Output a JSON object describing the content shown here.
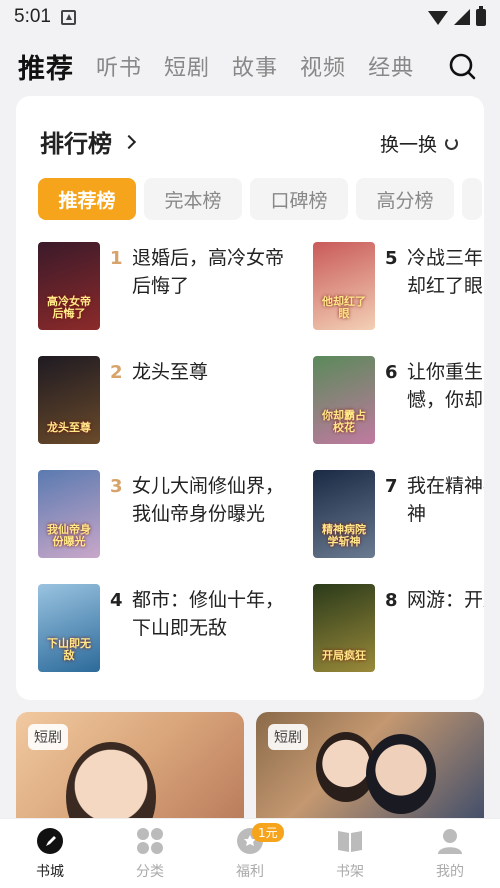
{
  "status_bar": {
    "time": "5:01"
  },
  "top_tabs": [
    {
      "label": "推荐",
      "active": true
    },
    {
      "label": "听书",
      "active": false
    },
    {
      "label": "短剧",
      "active": false
    },
    {
      "label": "故事",
      "active": false
    },
    {
      "label": "视频",
      "active": false
    },
    {
      "label": "经典",
      "active": false
    }
  ],
  "ranking": {
    "title": "排行榜",
    "refresh_label": "换一换",
    "tabs": [
      "推荐榜",
      "完本榜",
      "口碑榜",
      "高分榜"
    ],
    "books": [
      {
        "rank": "1",
        "title": "退婚后，高冷女帝后悔了",
        "cover_text": "高冷女帝后悔了",
        "cover_colors": [
          "#3a1a2a",
          "#8c2a2a"
        ]
      },
      {
        "rank": "2",
        "title": "龙头至尊",
        "cover_text": "龙头至尊",
        "cover_colors": [
          "#1e1a22",
          "#6a4a2a"
        ]
      },
      {
        "rank": "3",
        "title": "女儿大闹修仙界，我仙帝身份曝光",
        "cover_text": "我仙帝身份曝光",
        "cover_colors": [
          "#5a7ab0",
          "#c9a7c9"
        ]
      },
      {
        "rank": "4",
        "title": "都市：修仙十年，下山即无敌",
        "cover_text": "下山即无敌",
        "cover_colors": [
          "#9ac3e0",
          "#2c6a9a"
        ]
      },
      {
        "rank": "5",
        "title": "冷战三年，离婚他却红了眼",
        "cover_text": "他却红了眼",
        "cover_colors": [
          "#c95a5a",
          "#f3d0b5"
        ]
      },
      {
        "rank": "6",
        "title": "让你重生，弥补遗憾，你却霸占校花",
        "cover_text": "你却霸占校花",
        "cover_colors": [
          "#5a8a5a",
          "#c07aa0"
        ]
      },
      {
        "rank": "7",
        "title": "我在精神病院学斩神",
        "cover_text": "精神病院学斩神",
        "cover_colors": [
          "#1a2a44",
          "#6a7a90"
        ]
      },
      {
        "rank": "8",
        "title": "网游：开局疯狂",
        "cover_text": "开局疯狂",
        "cover_colors": [
          "#2a3a1a",
          "#9a8a3a"
        ]
      }
    ]
  },
  "drama_cards": [
    {
      "tag": "短剧"
    },
    {
      "tag": "短剧"
    }
  ],
  "bottom_nav": [
    {
      "label": "书城",
      "icon": "compass-icon",
      "active": true
    },
    {
      "label": "分类",
      "icon": "grid-icon",
      "active": false
    },
    {
      "label": "福利",
      "icon": "gift-icon",
      "active": false,
      "badge": "1元"
    },
    {
      "label": "书架",
      "icon": "book-icon",
      "active": false
    },
    {
      "label": "我的",
      "icon": "user-icon",
      "active": false
    }
  ],
  "colors": {
    "accent": "#f6a41c",
    "rank_top": "#d7a36b"
  }
}
